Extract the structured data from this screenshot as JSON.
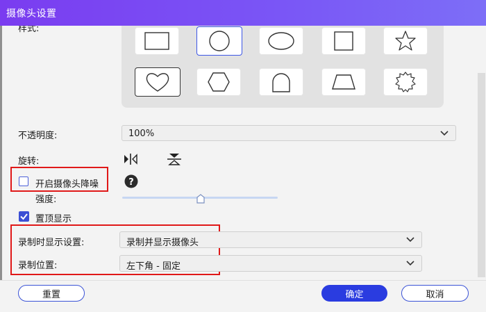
{
  "window": {
    "title": "摄像头设置"
  },
  "shape_section": {
    "label": "样式:",
    "shapes": [
      "rectangle",
      "circle",
      "ellipse",
      "square",
      "star",
      "heart",
      "hexagon",
      "arch",
      "trapezoid",
      "badge"
    ],
    "selected": "circle"
  },
  "opacity": {
    "label": "不透明度:",
    "value": "100%"
  },
  "rotate": {
    "label": "旋转:",
    "icons": [
      "flip-horizontal-icon",
      "flip-vertical-icon"
    ]
  },
  "denoise": {
    "label": "开启摄像头降噪",
    "checked": false,
    "strength_label": "强度:",
    "help_icon": "help-icon"
  },
  "ontop": {
    "label": "置顶显示",
    "checked": true
  },
  "record_display": {
    "label": "录制时显示设置:",
    "value": "录制并显示摄像头"
  },
  "record_position": {
    "label": "录制位置:",
    "value": "左下角 - 固定"
  },
  "footer": {
    "reset": "重置",
    "ok": "确定",
    "cancel": "取消"
  },
  "colors": {
    "accent": "#2a3ce0",
    "title_bar": "#7a57f6",
    "highlight_box": "#e01818"
  }
}
